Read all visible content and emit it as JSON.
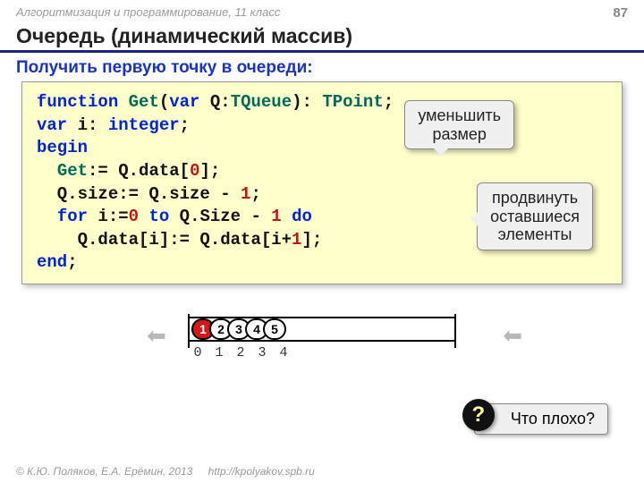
{
  "header": {
    "course": "Алгоритмизация и программирование, 11 класс",
    "page": "87"
  },
  "title": "Очередь (динамический массив)",
  "subtitle": "Получить первую точку в очереди:",
  "code": {
    "l1a": "function ",
    "l1b": "Get",
    "l1c": "(",
    "l1d": "var",
    "l1e": " Q:",
    "l1f": "TQueue",
    "l1g": "): ",
    "l1h": "TPoint",
    "l1i": ";",
    "l2a": "var",
    "l2b": " i: ",
    "l2c": "integer",
    "l2d": ";",
    "l3": "begin",
    "l4a": "  ",
    "l4b": "Get",
    "l4c": ":= Q.data[",
    "l4d": "0",
    "l4e": "];",
    "l5a": "  Q.size:= Q.size - ",
    "l5b": "1",
    "l5c": ";",
    "l6a": "  ",
    "l6b": "for",
    "l6c": " i:=",
    "l6d": "0",
    "l6e": " ",
    "l6f": "to",
    "l6g": " Q.Size - ",
    "l6h": "1",
    "l6i": " ",
    "l6j": "do",
    "l7a": "    Q.data[i]:= Q.data[i+",
    "l7b": "1",
    "l7c": "];",
    "l8": "end",
    "l8b": ";"
  },
  "callouts": {
    "reduce": "уменьшить\nразмер",
    "shift": "продвинуть\nоставшиеся\nэлементы"
  },
  "queue": {
    "cells": [
      "1",
      "2",
      "3",
      "4",
      "5"
    ],
    "indices": [
      "0",
      "1",
      "2",
      "3",
      "4"
    ],
    "arrow": "⬅"
  },
  "question": {
    "badge": "?",
    "text": "Что плохо?"
  },
  "footer": {
    "copyright": "© К.Ю. Поляков, Е.А. Ерёмин, 2013",
    "url": "http://kpolyakov.spb.ru"
  }
}
